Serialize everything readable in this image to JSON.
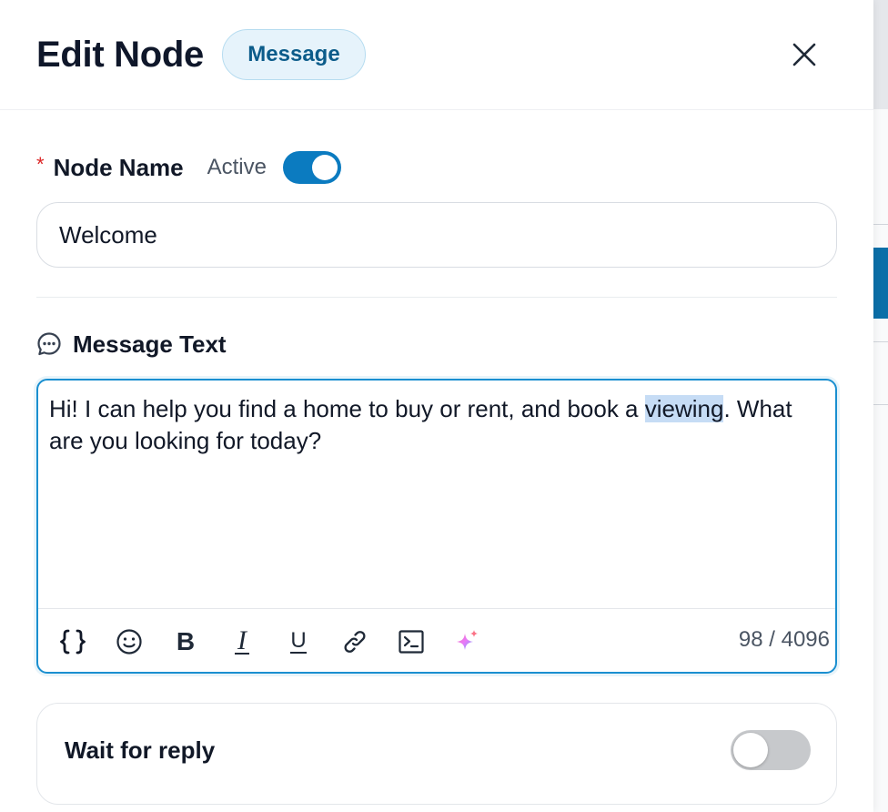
{
  "header": {
    "title": "Edit Node",
    "type_badge": "Message"
  },
  "node_name": {
    "required_mark": "*",
    "label": "Node Name",
    "active_label": "Active",
    "active": true,
    "value": "Welcome"
  },
  "message": {
    "label": "Message Text",
    "text_before": "Hi! I can help you find a home to buy or rent, and book a ",
    "text_selected": "viewing",
    "text_after": ". What are you looking for today?",
    "counter": "98 / 4096",
    "toolbar": {
      "variables_icon": "curly-braces-icon",
      "emoji_icon": "smiley-icon",
      "bold_label": "B",
      "italic_label": "I",
      "underline_label": "U",
      "link_icon": "link-icon",
      "code_icon": "terminal-icon",
      "ai_icon": "sparkle-icon"
    }
  },
  "wait_for_reply": {
    "label": "Wait for reply",
    "enabled": false
  },
  "colors": {
    "accent": "#0b7bc0",
    "badge_text": "#0b5c8a",
    "badge_bg": "#e6f3fb",
    "required": "#dc2626",
    "selection": "#c6dcf5"
  }
}
